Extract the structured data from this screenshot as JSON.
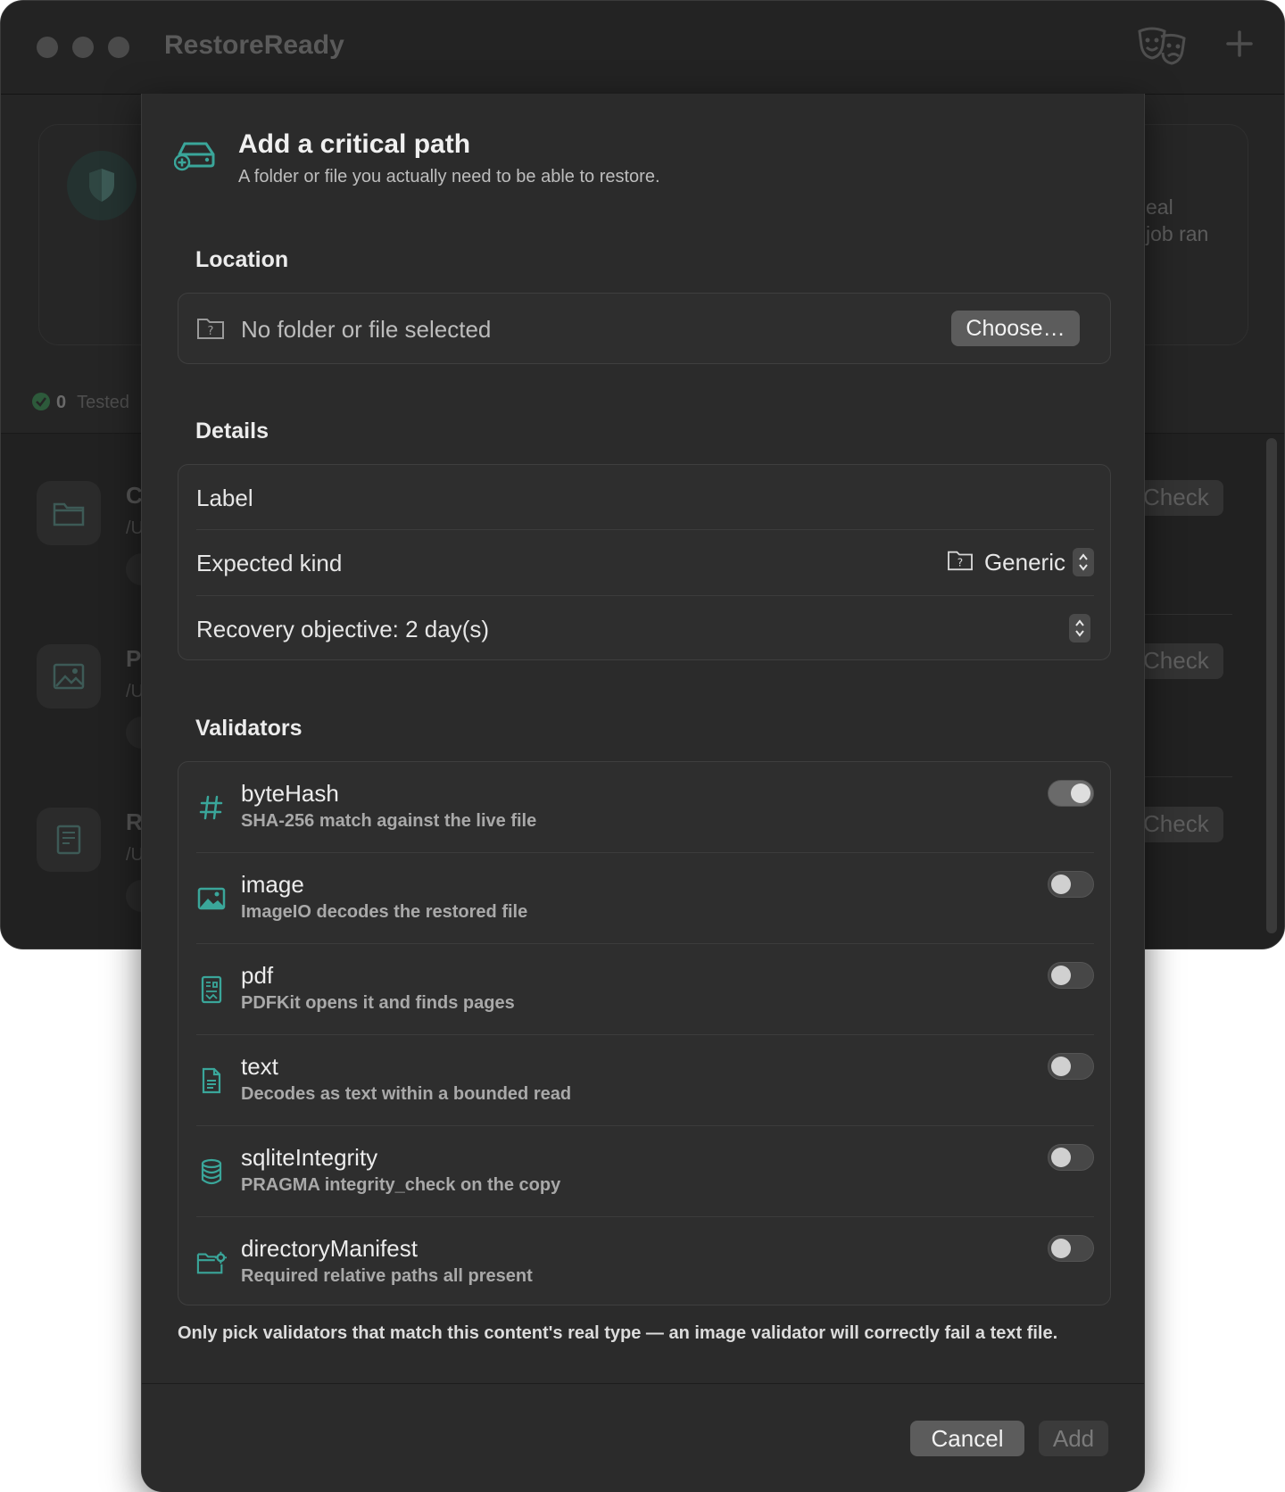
{
  "window": {
    "title": "RestoreReady",
    "traffic_colors": [
      "#4a4a4a",
      "#4a4a4a",
      "#4a4a4a"
    ]
  },
  "background": {
    "card_text_line1": "eal",
    "card_text_line2": "job ran",
    "stat_count": "0",
    "stat_label": "Tested",
    "rows": [
      {
        "letter": "C",
        "path": "/U",
        "icon": "folder-icon",
        "check_label": "Check"
      },
      {
        "letter": "P",
        "path": "/U",
        "icon": "photo-icon",
        "check_label": "Check"
      },
      {
        "letter": "R",
        "path": "/U",
        "icon": "document-icon",
        "check_label": "Check"
      }
    ]
  },
  "sheet": {
    "title": "Add a critical path",
    "subtitle": "A folder or file you actually need to be able to restore.",
    "location": {
      "section_title": "Location",
      "placeholder": "No folder or file selected",
      "choose_label": "Choose…"
    },
    "details": {
      "section_title": "Details",
      "label_field": "Label",
      "expected_kind_label": "Expected kind",
      "expected_kind_value": "Generic",
      "recovery_objective": "Recovery objective: 2 day(s)"
    },
    "validators": {
      "section_title": "Validators",
      "items": [
        {
          "name": "byteHash",
          "description": "SHA-256 match against the live file",
          "icon": "hash-icon",
          "enabled": true
        },
        {
          "name": "image",
          "description": "ImageIO decodes the restored file",
          "icon": "photo-icon",
          "enabled": false
        },
        {
          "name": "pdf",
          "description": "PDFKit opens it and finds pages",
          "icon": "pdf-icon",
          "enabled": false
        },
        {
          "name": "text",
          "description": "Decodes as text within a bounded read",
          "icon": "text-document-icon",
          "enabled": false
        },
        {
          "name": "sqliteIntegrity",
          "description": "PRAGMA integrity_check on the copy",
          "icon": "database-icon",
          "enabled": false
        },
        {
          "name": "directoryManifest",
          "description": "Required relative paths all present",
          "icon": "folder-gear-icon",
          "enabled": false
        }
      ]
    },
    "footnote": "Only pick validators that match this content's real type — an image validator will correctly fail a text file.",
    "cancel_label": "Cancel",
    "add_label": "Add"
  },
  "colors": {
    "accent": "#3aa69a",
    "sheet_bg": "#2b2b2b",
    "window_bg": "#252525"
  }
}
